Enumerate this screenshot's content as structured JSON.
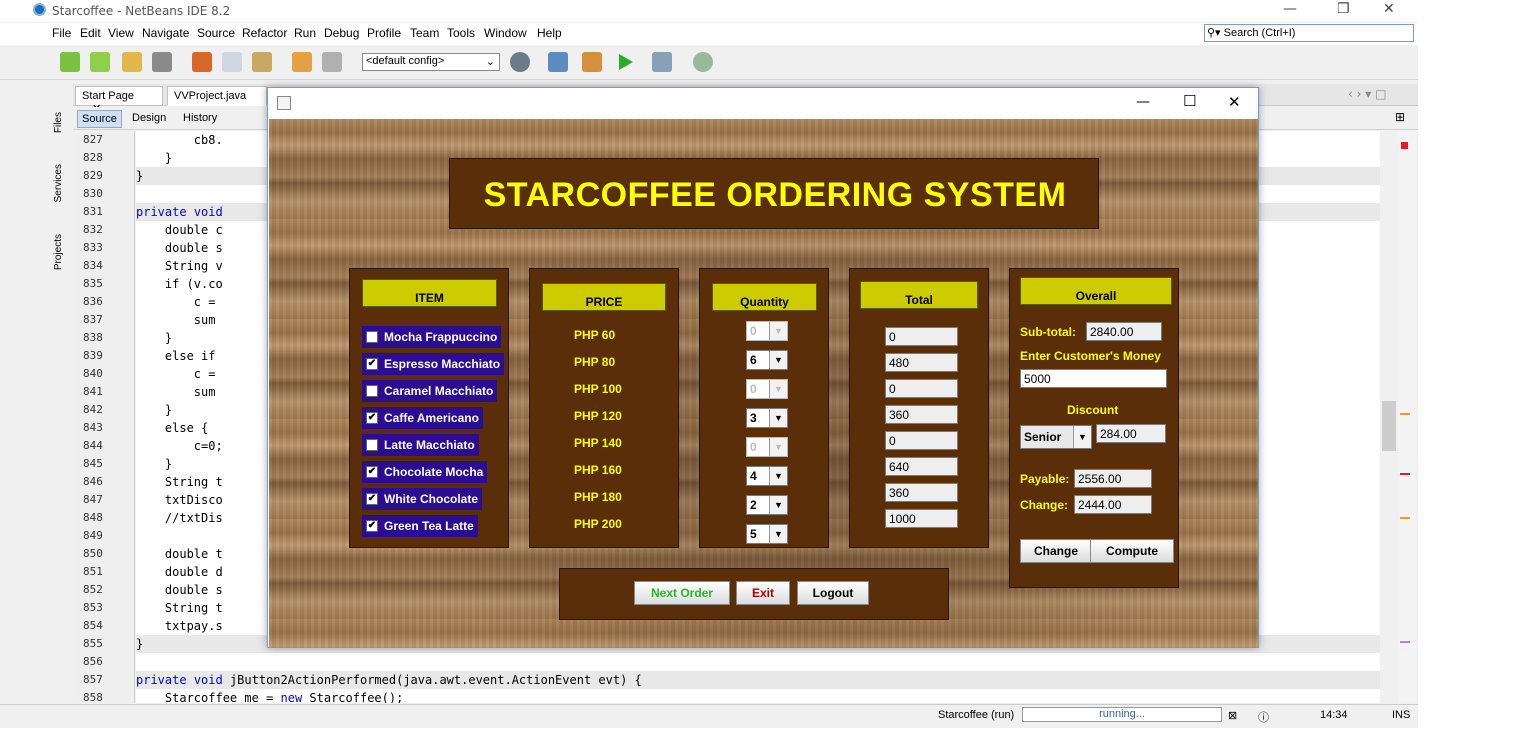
{
  "ide": {
    "title": "Starcoffee - NetBeans IDE 8.2",
    "menu": [
      "File",
      "Edit",
      "View",
      "Navigate",
      "Source",
      "Refactor",
      "Run",
      "Debug",
      "Profile",
      "Team",
      "Tools",
      "Window",
      "Help"
    ],
    "search_placeholder": "Search (Ctrl+I)",
    "config": "<default config>",
    "side_tabs": [
      "Files",
      "Services",
      "Projects"
    ],
    "file_tabs": [
      "Start Page",
      "VVProject.java"
    ],
    "editor_modes": [
      "Source",
      "Design",
      "History"
    ],
    "line_numbers": [
      "827",
      "828",
      "829",
      "830",
      "831",
      "832",
      "833",
      "834",
      "835",
      "836",
      "837",
      "838",
      "839",
      "840",
      "841",
      "842",
      "843",
      "844",
      "845",
      "846",
      "847",
      "848",
      "849",
      "850",
      "851",
      "852",
      "853",
      "854",
      "855",
      "856",
      "857",
      "858"
    ],
    "code_lines": [
      "        cb8.",
      "    }",
      "}",
      "",
      "private void",
      "    double c",
      "    double s",
      "    String v",
      "    if (v.co",
      "        c =",
      "        sum",
      "    }",
      "    else if",
      "        c =",
      "        sum",
      "    }",
      "    else {",
      "        c=0;",
      "    }",
      "    String t",
      "    txtDisco",
      "    //txtDis",
      "",
      "    double t",
      "    double d",
      "    double s",
      "    String t",
      "    txtpay.s",
      "}",
      "",
      "private void jButton2ActionPerformed(java.awt.event.ActionEvent evt) {",
      "    Starcoffee me = new Starcoffee();"
    ],
    "status_project": "Starcoffee (run)",
    "status_progress": "running...",
    "status_time": "14:34",
    "status_mode": "INS"
  },
  "app": {
    "banner": "STARCOFFEE ORDERING SYSTEM",
    "headers": {
      "item": "ITEM",
      "price": "PRICE",
      "quantity": "Quantity",
      "total": "Total",
      "overall": "Overall"
    },
    "items": [
      {
        "name": "Mocha Frappuccino",
        "checked": false,
        "price": "PHP 60",
        "qty": "0",
        "qty_enabled": false,
        "total": "0"
      },
      {
        "name": "Espresso Macchiato",
        "checked": true,
        "price": "PHP 80",
        "qty": "6",
        "qty_enabled": true,
        "total": "480"
      },
      {
        "name": "Caramel Macchiato",
        "checked": false,
        "price": "PHP 100",
        "qty": "0",
        "qty_enabled": false,
        "total": "0"
      },
      {
        "name": "Caffe Americano",
        "checked": true,
        "price": "PHP 120",
        "qty": "3",
        "qty_enabled": true,
        "total": "360"
      },
      {
        "name": "Latte Macchiato",
        "checked": false,
        "price": "PHP 140",
        "qty": "0",
        "qty_enabled": false,
        "total": "0"
      },
      {
        "name": "Chocolate Mocha",
        "checked": true,
        "price": "PHP 160",
        "qty": "4",
        "qty_enabled": true,
        "total": "640"
      },
      {
        "name": "White Chocolate",
        "checked": true,
        "price": "PHP 180",
        "qty": "2",
        "qty_enabled": true,
        "total": "360"
      },
      {
        "name": "Green Tea Latte",
        "checked": true,
        "price": "PHP 200",
        "qty": "5",
        "qty_enabled": true,
        "total": "1000"
      }
    ],
    "overall": {
      "subtotal_label": "Sub-total:",
      "subtotal": "2840.00",
      "money_label": "Enter Customer's Money",
      "money": "5000",
      "discount_label": "Discount",
      "discount_type": "Senior",
      "discount": "284.00",
      "payable_label": "Payable:",
      "payable": "2556.00",
      "change_label": "Change:",
      "change": "2444.00",
      "change_button": "Change",
      "compute_button": "Compute"
    },
    "buttons": {
      "next": "Next Order",
      "exit": "Exit",
      "logout": "Logout"
    },
    "colors": {
      "panel": "#5a2e08",
      "header": "#cccc00",
      "label": "#ffff00",
      "checkbox_bg": "#2b0c92",
      "next": "#22bb22",
      "exit": "#aa0000"
    }
  }
}
